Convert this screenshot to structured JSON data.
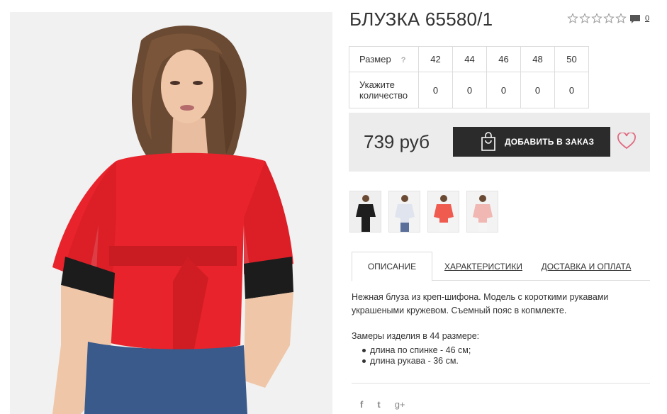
{
  "product": {
    "title": "БЛУЗКА 65580/1",
    "rating_stars": 5,
    "rating_value": 0,
    "comment_count": "0",
    "price": "739 руб",
    "order_button": "ДОБАВИТЬ В ЗАКАЗ"
  },
  "size_table": {
    "size_label": "Размер",
    "help_mark": "?",
    "qty_label": "Укажите количество",
    "sizes": [
      "42",
      "44",
      "46",
      "48",
      "50"
    ],
    "quantities": [
      "0",
      "0",
      "0",
      "0",
      "0"
    ]
  },
  "thumbnails": [
    "black-blouse",
    "white-blouse",
    "red-blouse",
    "pink-blouse"
  ],
  "tabs": {
    "description": "ОПИСАНИЕ",
    "characteristics": "ХАРАКТЕРИСТИКИ",
    "delivery": "ДОСТАВКА И ОПЛАТА"
  },
  "description": {
    "text": "Нежная блуза из креп-шифона. Модель с короткими рукавами украшеными кружевом. Съемный пояс в копмлекте.",
    "measurements_title": "Замеры изделия в 44 размере:",
    "measurements": [
      "длина по спинке - 46 см;",
      "длина рукава - 36 см."
    ]
  },
  "social": [
    "f",
    "t",
    "g+"
  ],
  "colors": {
    "accent": "#2b2b2b",
    "heart": "#e16b82",
    "blouse_red": "#e8232b"
  }
}
